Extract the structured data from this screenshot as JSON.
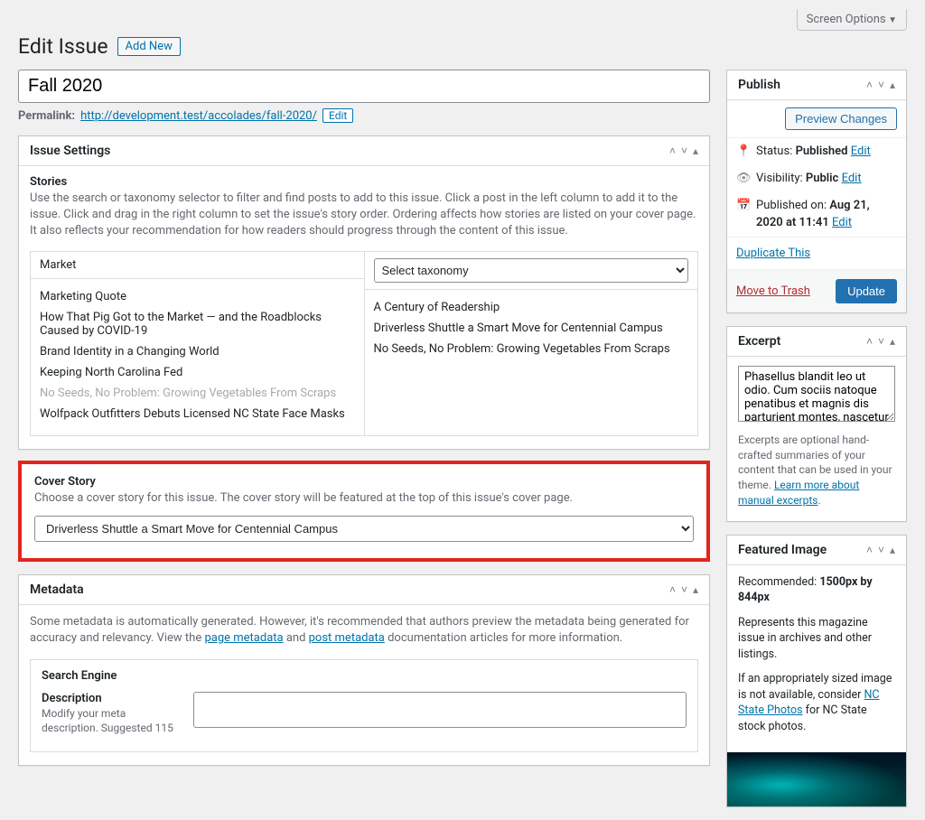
{
  "screen_options": "Screen Options",
  "page_title": "Edit Issue",
  "add_new": "Add New",
  "title_value": "Fall 2020",
  "permalink": {
    "label": "Permalink:",
    "url": "http://development.test/accolades/fall-2020/",
    "edit": "Edit"
  },
  "issue_settings": {
    "heading": "Issue Settings",
    "stories_label": "Stories",
    "stories_help": "Use the search or taxonomy selector to filter and find posts to add to this issue. Click a post in the left column to add it to the issue. Click and drag in the right column to set the issue's story order. Ordering affects how stories are listed on your cover page. It also reflects your recommendation for how readers should progress through the content of this issue.",
    "left_filter": "Market",
    "taxonomy_placeholder": "Select taxonomy",
    "left_items": [
      {
        "label": "Marketing Quote",
        "muted": false
      },
      {
        "label": "How That Pig Got to the Market — and the Roadblocks Caused by COVID-19",
        "muted": false
      },
      {
        "label": "Brand Identity in a Changing World",
        "muted": false
      },
      {
        "label": "Keeping North Carolina Fed",
        "muted": false
      },
      {
        "label": "No Seeds, No Problem: Growing Vegetables From Scraps",
        "muted": true
      },
      {
        "label": "Wolfpack Outfitters Debuts Licensed NC State Face Masks",
        "muted": false
      }
    ],
    "right_items": [
      "A Century of Readership",
      "Driverless Shuttle a Smart Move for Centennial Campus",
      "No Seeds, No Problem: Growing Vegetables From Scraps"
    ]
  },
  "cover_story": {
    "heading": "Cover Story",
    "help": "Choose a cover story for this issue. The cover story will be featured at the top of this issue's cover page.",
    "selected": "Driverless Shuttle a Smart Move for Centennial Campus"
  },
  "metadata": {
    "heading": "Metadata",
    "text_pre": "Some metadata is automatically generated. However, it's recommended that authors preview the metadata being generated for accuracy and relevancy. View the ",
    "link1": "page metadata",
    "text_mid": " and ",
    "link2": "post metadata",
    "text_post": " documentation articles for more information.",
    "search_engine": {
      "heading": "Search Engine",
      "desc_label": "Description",
      "desc_help": "Modify your meta description. Suggested 115"
    }
  },
  "publish": {
    "heading": "Publish",
    "preview": "Preview Changes",
    "status_label": "Status:",
    "status_value": "Published",
    "visibility_label": "Visibility:",
    "visibility_value": "Public",
    "published_label": "Published on:",
    "published_value": "Aug 21, 2020 at 11:41",
    "edit": "Edit",
    "duplicate": "Duplicate This",
    "trash": "Move to Trash",
    "update": "Update"
  },
  "excerpt": {
    "heading": "Excerpt",
    "value": "Phasellus blandit leo ut odio. Cum sociis natoque penatibus et magnis dis parturient montes, nascetur",
    "help_pre": "Excerpts are optional hand-crafted summaries of your content that can be used in your theme. ",
    "help_link": "Learn more about manual excerpts",
    "help_post": "."
  },
  "featured_image": {
    "heading": "Featured Image",
    "rec_pre": "Recommended: ",
    "rec_val": "1500px by 844px",
    "desc": "Represents this magazine issue in archives and other listings.",
    "appropriate_pre": "If an appropriately sized image is not available, consider ",
    "appropriate_link": "NC State Photos",
    "appropriate_post": " for NC State stock photos."
  }
}
